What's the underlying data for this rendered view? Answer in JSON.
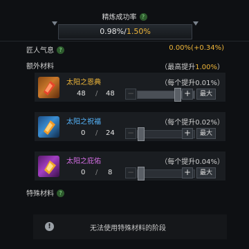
{
  "header": {
    "title": "精炼成功率",
    "help": "?",
    "rate": "0.98%",
    "slash": "/",
    "max_rate": "1.50%"
  },
  "artisan": {
    "label": "匠人气息",
    "help": "?",
    "value": "0.00%(+0.34%)"
  },
  "extra_materials": {
    "label": "额外材料",
    "cap_prefix": "（最高提升",
    "cap_value": "1.00%",
    "cap_suffix": "）"
  },
  "materials": [
    {
      "name": "太阳之恩典",
      "name_color": "#f0b73a",
      "owned": "48",
      "sep": "/",
      "max": "48",
      "per": "（每个提升0.01%）",
      "fill": 1.0
    },
    {
      "name": "太阳之祝福",
      "name_color": "#56b7ff",
      "owned": "0",
      "sep": "/",
      "max": "24",
      "per": "（每个提升0.02%）",
      "fill": 0.0
    },
    {
      "name": "太阳之庇佑",
      "name_color": "#d870e8",
      "owned": "0",
      "sep": "/",
      "max": "8",
      "per": "（每个提升0.04%）",
      "fill": 0.0
    }
  ],
  "buttons": {
    "minus": "−",
    "plus": "+",
    "max": "最大"
  },
  "special": {
    "label": "特殊材料",
    "help": "?",
    "info_icon": "!",
    "message": "无法使用特殊材料的阶段"
  },
  "colors": {
    "gold": "#f0b73a",
    "blue": "#56b7ff",
    "purple": "#d870e8",
    "green_badge": "#2d5b2d"
  }
}
